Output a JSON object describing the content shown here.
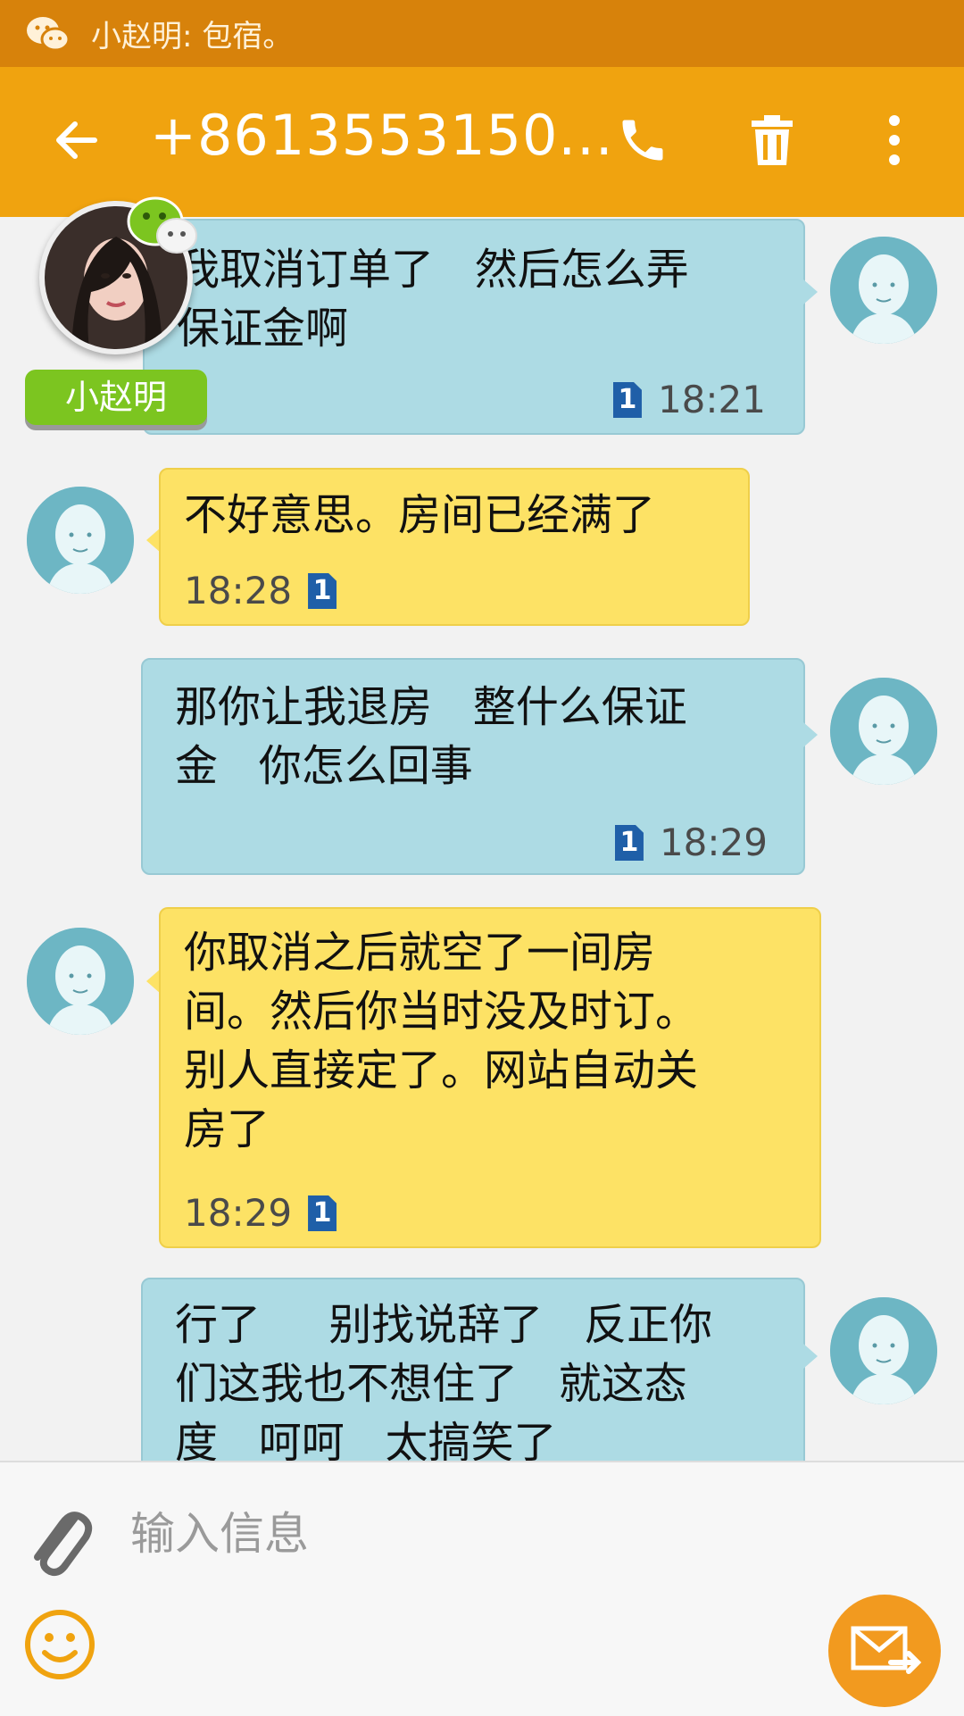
{
  "status_bar": {
    "notification_app_icon": "wechat-icon",
    "notification_text": "小赵明: 包宿。"
  },
  "app_bar": {
    "title": "+8613553150...",
    "icons": [
      "back-arrow-icon",
      "phone-icon",
      "trash-icon",
      "more-vert-icon"
    ]
  },
  "floating_contact": {
    "name": "小赵明",
    "badge_icon": "wechat-icon"
  },
  "messages": [
    {
      "direction": "sent",
      "text": "我取消订单了   然后怎么弄\n保证金啊",
      "sim": "1",
      "time": "18:21"
    },
    {
      "direction": "received",
      "text": "不好意思。房间已经满了",
      "sim": "1",
      "time": "18:28"
    },
    {
      "direction": "sent",
      "text": "那你让我退房   整什么保证\n金   你怎么回事",
      "sim": "1",
      "time": "18:29"
    },
    {
      "direction": "received",
      "text": "你取消之后就空了一间房\n间。然后你当时没及时订。\n别人直接定了。网站自动关\n房了",
      "sim": "1",
      "time": "18:29"
    },
    {
      "direction": "sent",
      "text": "行了     别找说辞了   反正你\n们这我也不想住了   就这态\n度   呵呵   太搞笑了",
      "sim": "",
      "time": ""
    }
  ],
  "input": {
    "placeholder": "输入信息",
    "icons": [
      "attach-icon",
      "emoji-icon",
      "send-icon"
    ]
  },
  "colors": {
    "status_bar": "#d7820b",
    "app_bar": "#f0a30f",
    "sent_bubble": "#addbe4",
    "received_bubble": "#fde265",
    "send_button": "#f29a1f",
    "wechat_green": "#7cc520"
  }
}
